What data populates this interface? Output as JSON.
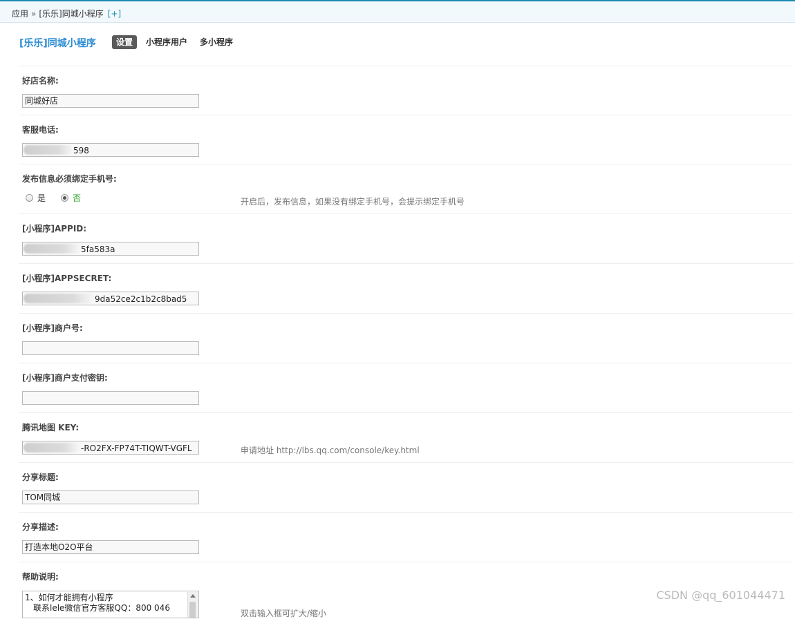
{
  "breadcrumb": {
    "root": "应用",
    "separator": "»",
    "current": "[乐乐]同城小程序",
    "add": "[+]"
  },
  "header": {
    "title": "[乐乐]同城小程序",
    "tabs": [
      {
        "label": "设置",
        "active": true
      },
      {
        "label": "小程序用户",
        "active": false
      },
      {
        "label": "多小程序",
        "active": false
      }
    ]
  },
  "form": {
    "shop_name": {
      "label": "好店名称:",
      "value": "同城好店"
    },
    "service_phone": {
      "label": "客服电话:",
      "value": "598"
    },
    "bind_phone": {
      "label": "发布信息必须绑定手机号:",
      "options": [
        "是",
        "否"
      ],
      "selected": "否",
      "hint": "开启后，发布信息，如果没有绑定手机号，会提示绑定手机号"
    },
    "appid": {
      "label": "[小程序]APPID:",
      "value": "5fa583a"
    },
    "appsecret": {
      "label": "[小程序]APPSECRET:",
      "value": "9da52ce2c1b2c8bad5"
    },
    "merchant_id": {
      "label": "[小程序]商户号:",
      "value": ""
    },
    "merchant_key": {
      "label": "[小程序]商户支付密钥:",
      "value": ""
    },
    "map_key": {
      "label": "腾讯地图 KEY:",
      "value": "-RO2FX-FP74T-TIQWT-VGFL",
      "hint": "申请地址 http://lbs.qq.com/console/key.html"
    },
    "share_title": {
      "label": "分享标题:",
      "value": "TOM同城"
    },
    "share_desc": {
      "label": "分享描述:",
      "value": "打造本地O2O平台"
    },
    "help": {
      "label": "帮助说明:",
      "line1": "1、如何才能拥有小程序",
      "line2": "联系lele微信官方客服QQ：800 046",
      "hint": "双击输入框可扩大/缩小"
    }
  },
  "watermark": "CSDN @qq_601044471",
  "colors": {
    "accent": "#1a8bb3",
    "title": "#2b8cd3",
    "active_tab": "#5a5a5a",
    "radio_no": "#2aa12a"
  }
}
